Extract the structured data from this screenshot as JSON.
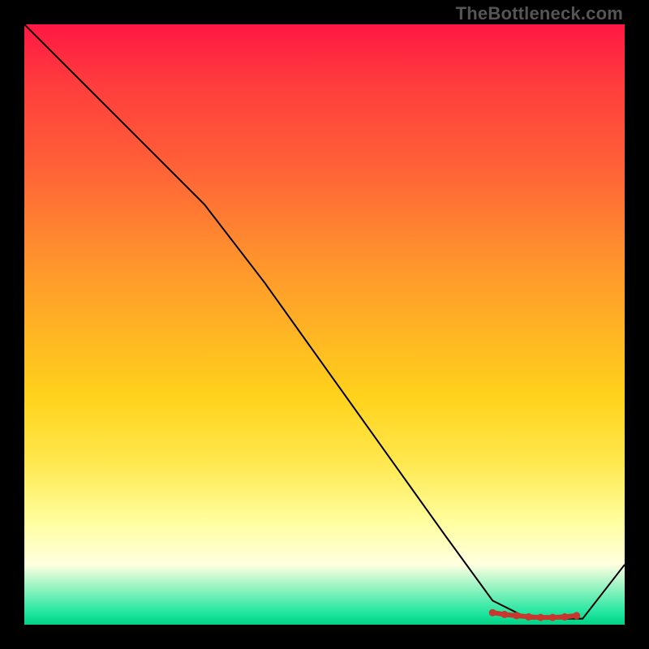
{
  "branding": {
    "watermark": "TheBottleneck.com"
  },
  "chart_data": {
    "type": "line",
    "title": "",
    "xlabel": "",
    "ylabel": "",
    "xlim": [
      0,
      100
    ],
    "ylim": [
      0,
      100
    ],
    "grid": false,
    "legend": false,
    "series": [
      {
        "name": "curve",
        "x": [
          0,
          10,
          22,
          30,
          40,
          50,
          60,
          70,
          78,
          84,
          90,
          93,
          100
        ],
        "values": [
          100,
          90,
          78,
          70,
          57,
          43,
          29,
          15,
          4,
          1,
          1,
          1,
          10
        ]
      }
    ],
    "markers": {
      "name": "highlight-cluster",
      "x": [
        78,
        80,
        82,
        84,
        86,
        88,
        90,
        92
      ],
      "values": [
        2,
        1.7,
        1.5,
        1.3,
        1.2,
        1.2,
        1.3,
        1.5
      ]
    },
    "background_gradient": {
      "stops": [
        {
          "pos": 0.0,
          "color": "#ff1744"
        },
        {
          "pos": 0.1,
          "color": "#ff3d3d"
        },
        {
          "pos": 0.22,
          "color": "#ff5c38"
        },
        {
          "pos": 0.38,
          "color": "#ff8f2e"
        },
        {
          "pos": 0.5,
          "color": "#ffb125"
        },
        {
          "pos": 0.62,
          "color": "#ffd21b"
        },
        {
          "pos": 0.73,
          "color": "#ffe84f"
        },
        {
          "pos": 0.83,
          "color": "#ffffa0"
        },
        {
          "pos": 0.9,
          "color": "#ffffe0"
        },
        {
          "pos": 0.98,
          "color": "#21e6a0"
        },
        {
          "pos": 1.0,
          "color": "#00d084"
        }
      ]
    }
  }
}
